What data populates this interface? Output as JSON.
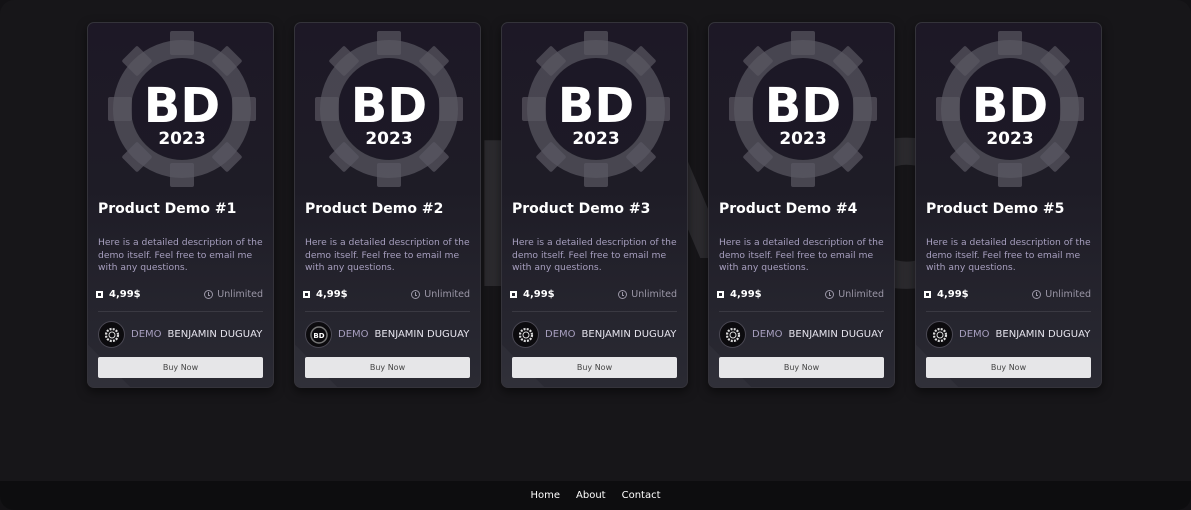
{
  "background": {
    "watermark": "DEMO"
  },
  "colors": {
    "accent": "#a79fbf",
    "page_bg": "#171619",
    "button_bg": "#e6e6e8"
  },
  "logo": {
    "letters": "BD",
    "year": "2023",
    "icon": "gear-logo-icon"
  },
  "cards": [
    {
      "title": "Product Demo #1",
      "description": "Here is a detailed description of the demo itself. Feel free to email me with any questions.",
      "price": "4,99$",
      "duration": "Unlimited",
      "author_tag": "DEMO",
      "author_name": "BENJAMIN DUGUAY",
      "button_label": "Buy Now"
    },
    {
      "title": "Product Demo #2",
      "description": "Here is a detailed description of the demo itself. Feel free to email me with any questions.",
      "price": "4,99$",
      "duration": "Unlimited",
      "author_tag": "DEMO",
      "author_name": "BENJAMIN DUGUAY",
      "button_label": "Buy Now"
    },
    {
      "title": "Product Demo #3",
      "description": "Here is a detailed description of the demo itself. Feel free to email me with any questions.",
      "price": "4,99$",
      "duration": "Unlimited",
      "author_tag": "DEMO",
      "author_name": "BENJAMIN DUGUAY",
      "button_label": "Buy Now"
    },
    {
      "title": "Product Demo #4",
      "description": "Here is a detailed description of the demo itself. Feel free to email me with any questions.",
      "price": "4,99$",
      "duration": "Unlimited",
      "author_tag": "DEMO",
      "author_name": "BENJAMIN DUGUAY",
      "button_label": "Buy Now"
    },
    {
      "title": "Product Demo #5",
      "description": "Here is a detailed description of the demo itself. Feel free to email me with any questions.",
      "price": "4,99$",
      "duration": "Unlimited",
      "author_tag": "DEMO",
      "author_name": "BENJAMIN DUGUAY",
      "button_label": "Buy Now"
    }
  ],
  "footer": {
    "links": [
      "Home",
      "About",
      "Contact"
    ]
  }
}
